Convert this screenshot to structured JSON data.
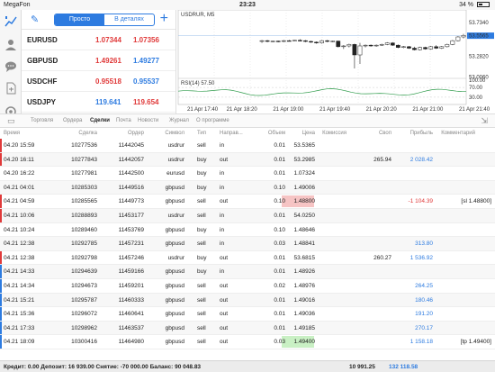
{
  "status": {
    "carrier": "MegaFon",
    "time": "23:23",
    "battery": "34 %"
  },
  "quotes": {
    "tab_simple": "Просто",
    "tab_detail": "В деталях",
    "rows": [
      {
        "symbol": "EURUSD",
        "bid": "1.07344",
        "ask": "1.07356",
        "bid_color": "#e03a3a",
        "ask_color": "#e03a3a"
      },
      {
        "symbol": "GBPUSD",
        "bid": "1.49261",
        "ask": "1.49277",
        "bid_color": "#e03a3a",
        "ask_color": "#2d7be0"
      },
      {
        "symbol": "USDCHF",
        "bid": "0.95518",
        "ask": "0.95537",
        "bid_color": "#e03a3a",
        "ask_color": "#2d7be0"
      },
      {
        "symbol": "USDJPY",
        "bid": "119.641",
        "ask": "119.654",
        "bid_color": "#2d7be0",
        "ask_color": "#e03a3a"
      }
    ]
  },
  "chart": {
    "title": "USDRUR, M5",
    "price_labels": [
      "53.7340",
      "53.5565",
      "53.2820",
      "53.0060"
    ],
    "current_price": "53.5565",
    "rsi_label": "RSI(14) 57.50",
    "rsi_levels": [
      "100.00",
      "70.00",
      "30.00"
    ],
    "time_labels": [
      "21 Apr 17:40",
      "21 Apr 18:20",
      "21 Apr 19:00",
      "21 Apr 19:40",
      "21 Apr 20:20",
      "21 Apr 21:00",
      "21 Apr 21:40"
    ],
    "candles": [
      {
        "o": 53.48,
        "h": 53.5,
        "l": 53.46,
        "c": 53.49
      },
      {
        "o": 53.49,
        "h": 53.5,
        "l": 53.47,
        "c": 53.48
      },
      {
        "o": 53.48,
        "h": 53.49,
        "l": 53.47,
        "c": 53.485
      },
      {
        "o": 53.485,
        "h": 53.49,
        "l": 53.47,
        "c": 53.48
      },
      {
        "o": 53.48,
        "h": 53.5,
        "l": 53.47,
        "c": 53.49
      },
      {
        "o": 53.49,
        "h": 53.5,
        "l": 53.48,
        "c": 53.485
      },
      {
        "o": 53.485,
        "h": 53.5,
        "l": 53.48,
        "c": 53.495
      },
      {
        "o": 53.495,
        "h": 53.51,
        "l": 53.48,
        "c": 53.49
      },
      {
        "o": 53.49,
        "h": 53.5,
        "l": 53.47,
        "c": 53.48
      },
      {
        "o": 53.48,
        "h": 53.49,
        "l": 53.46,
        "c": 53.47
      },
      {
        "o": 53.47,
        "h": 53.48,
        "l": 53.45,
        "c": 53.46
      },
      {
        "o": 53.46,
        "h": 53.5,
        "l": 53.45,
        "c": 53.49
      },
      {
        "o": 53.49,
        "h": 53.5,
        "l": 53.47,
        "c": 53.48
      },
      {
        "o": 53.48,
        "h": 53.49,
        "l": 53.47,
        "c": 53.485
      },
      {
        "o": 53.485,
        "h": 53.49,
        "l": 53.4,
        "c": 53.41
      },
      {
        "o": 53.41,
        "h": 53.43,
        "l": 53.38,
        "c": 53.42
      },
      {
        "o": 53.42,
        "h": 53.45,
        "l": 53.4,
        "c": 53.44
      },
      {
        "o": 53.44,
        "h": 53.45,
        "l": 53.12,
        "c": 53.3
      },
      {
        "o": 53.3,
        "h": 53.46,
        "l": 53.18,
        "c": 53.42
      },
      {
        "o": 53.42,
        "h": 53.44,
        "l": 53.4,
        "c": 53.43
      },
      {
        "o": 53.43,
        "h": 53.44,
        "l": 53.41,
        "c": 53.42
      },
      {
        "o": 53.42,
        "h": 53.44,
        "l": 53.41,
        "c": 53.43
      },
      {
        "o": 53.43,
        "h": 53.45,
        "l": 53.42,
        "c": 53.44
      },
      {
        "o": 53.44,
        "h": 53.47,
        "l": 53.43,
        "c": 53.46
      },
      {
        "o": 53.46,
        "h": 53.47,
        "l": 53.42,
        "c": 53.43
      },
      {
        "o": 53.43,
        "h": 53.44,
        "l": 53.39,
        "c": 53.4
      },
      {
        "o": 53.4,
        "h": 53.42,
        "l": 53.39,
        "c": 53.41
      },
      {
        "o": 53.41,
        "h": 53.42,
        "l": 53.38,
        "c": 53.39
      },
      {
        "o": 53.39,
        "h": 53.41,
        "l": 53.36,
        "c": 53.37
      },
      {
        "o": 53.37,
        "h": 53.41,
        "l": 53.36,
        "c": 53.4
      },
      {
        "o": 53.4,
        "h": 53.41,
        "l": 53.37,
        "c": 53.38
      },
      {
        "o": 53.38,
        "h": 53.42,
        "l": 53.37,
        "c": 53.41
      },
      {
        "o": 53.41,
        "h": 53.43,
        "l": 53.38,
        "c": 53.39
      },
      {
        "o": 53.39,
        "h": 53.42,
        "l": 53.38,
        "c": 53.41
      },
      {
        "o": 53.41,
        "h": 53.45,
        "l": 53.4,
        "c": 53.44
      },
      {
        "o": 53.44,
        "h": 53.5,
        "l": 53.43,
        "c": 53.49
      },
      {
        "o": 53.49,
        "h": 53.55,
        "l": 53.48,
        "c": 53.54
      },
      {
        "o": 53.54,
        "h": 53.58,
        "l": 53.52,
        "c": 53.56
      }
    ]
  },
  "tabs": {
    "items": [
      "Торговля",
      "Ордера",
      "Сделки",
      "Почта",
      "Новости",
      "Журнал",
      "О программе"
    ],
    "active": 2
  },
  "table": {
    "headers": [
      "Время",
      "Сделка",
      "Ордер",
      "Символ",
      "Тип",
      "Направ...",
      "Объем",
      "Цена",
      "Комиссия",
      "Своп",
      "Прибыль",
      "Комментарий"
    ],
    "rows": [
      {
        "time": "04.20 15:59",
        "deal": "10277536",
        "order": "11442045",
        "symbol": "usdrur",
        "type": "sell",
        "dir": "in",
        "vol": "0.01",
        "price": "53.5365",
        "commission": "",
        "swap": "",
        "profit": "",
        "comment": "",
        "mark": "#e03a3a",
        "hl": ""
      },
      {
        "time": "04.20 16:11",
        "deal": "10277843",
        "order": "11442057",
        "symbol": "usdrur",
        "type": "buy",
        "dir": "out",
        "vol": "0.01",
        "price": "53.2985",
        "commission": "",
        "swap": "265.94",
        "profit": "2 028.42",
        "comment": "",
        "mark": "#e03a3a",
        "hl": ""
      },
      {
        "time": "04.20 16:22",
        "deal": "10277981",
        "order": "11442500",
        "symbol": "eurusd",
        "type": "buy",
        "dir": "in",
        "vol": "0.01",
        "price": "1.07324",
        "commission": "",
        "swap": "",
        "profit": "",
        "comment": "",
        "mark": "",
        "hl": ""
      },
      {
        "time": "04.21 04:01",
        "deal": "10285303",
        "order": "11449516",
        "symbol": "gbpusd",
        "type": "buy",
        "dir": "in",
        "vol": "0.10",
        "price": "1.49006",
        "commission": "",
        "swap": "",
        "profit": "",
        "comment": "",
        "mark": "",
        "hl": ""
      },
      {
        "time": "04.21 04:59",
        "deal": "10285565",
        "order": "11449773",
        "symbol": "gbpusd",
        "type": "sell",
        "dir": "out",
        "vol": "0.10",
        "price": "1.48800",
        "commission": "",
        "swap": "",
        "profit": "-1 104.39",
        "comment": "[sl 1.48800]",
        "mark": "#e03a3a",
        "hl": "red"
      },
      {
        "time": "04.21 10:06",
        "deal": "10288893",
        "order": "11453177",
        "symbol": "usdrur",
        "type": "sell",
        "dir": "in",
        "vol": "0.01",
        "price": "54.0250",
        "commission": "",
        "swap": "",
        "profit": "",
        "comment": "",
        "mark": "#e03a3a",
        "hl": ""
      },
      {
        "time": "04.21 10:24",
        "deal": "10289460",
        "order": "11453769",
        "symbol": "gbpusd",
        "type": "buy",
        "dir": "in",
        "vol": "0.10",
        "price": "1.48646",
        "commission": "",
        "swap": "",
        "profit": "",
        "comment": "",
        "mark": "",
        "hl": ""
      },
      {
        "time": "04.21 12:38",
        "deal": "10292785",
        "order": "11457231",
        "symbol": "gbpusd",
        "type": "sell",
        "dir": "in",
        "vol": "0.03",
        "price": "1.48841",
        "commission": "",
        "swap": "",
        "profit": "313.80",
        "comment": "",
        "mark": "",
        "hl": ""
      },
      {
        "time": "04.21 12:38",
        "deal": "10292798",
        "order": "11457246",
        "symbol": "usdrur",
        "type": "buy",
        "dir": "out",
        "vol": "0.01",
        "price": "53.6815",
        "commission": "",
        "swap": "260.27",
        "profit": "1 536.92",
        "comment": "",
        "mark": "#e03a3a",
        "hl": ""
      },
      {
        "time": "04.21 14:33",
        "deal": "10294639",
        "order": "11459166",
        "symbol": "gbpusd",
        "type": "buy",
        "dir": "in",
        "vol": "0.01",
        "price": "1.48926",
        "commission": "",
        "swap": "",
        "profit": "",
        "comment": "",
        "mark": "#2d7be0",
        "hl": ""
      },
      {
        "time": "04.21 14:34",
        "deal": "10294673",
        "order": "11459201",
        "symbol": "gbpusd",
        "type": "sell",
        "dir": "out",
        "vol": "0.02",
        "price": "1.48976",
        "commission": "",
        "swap": "",
        "profit": "264.25",
        "comment": "",
        "mark": "#2d7be0",
        "hl": ""
      },
      {
        "time": "04.21 15:21",
        "deal": "10295787",
        "order": "11460333",
        "symbol": "gbpusd",
        "type": "sell",
        "dir": "out",
        "vol": "0.01",
        "price": "1.49016",
        "commission": "",
        "swap": "",
        "profit": "180.46",
        "comment": "",
        "mark": "#2d7be0",
        "hl": ""
      },
      {
        "time": "04.21 15:36",
        "deal": "10296072",
        "order": "11460641",
        "symbol": "gbpusd",
        "type": "sell",
        "dir": "out",
        "vol": "0.01",
        "price": "1.49036",
        "commission": "",
        "swap": "",
        "profit": "191.20",
        "comment": "",
        "mark": "#2d7be0",
        "hl": ""
      },
      {
        "time": "04.21 17:33",
        "deal": "10298962",
        "order": "11463537",
        "symbol": "gbpusd",
        "type": "sell",
        "dir": "out",
        "vol": "0.01",
        "price": "1.49185",
        "commission": "",
        "swap": "",
        "profit": "270.17",
        "comment": "",
        "mark": "#2d7be0",
        "hl": ""
      },
      {
        "time": "04.21 18:09",
        "deal": "10300416",
        "order": "11464980",
        "symbol": "gbpusd",
        "type": "sell",
        "dir": "out",
        "vol": "0.03",
        "price": "1.49400",
        "commission": "",
        "swap": "",
        "profit": "1 158.18",
        "comment": "[tp 1.49400]",
        "mark": "#2d7be0",
        "hl": "green"
      }
    ]
  },
  "footer": {
    "summary": "Кредит: 0.00 Депозит: 16 939.00 Снятие: -70 000.00 Баланс: 90 048.83",
    "swap_total": "10 991.25",
    "profit_total": "132 118.58"
  },
  "colors": {
    "accent": "#2d7be0",
    "down": "#e03a3a",
    "profit": "#2d7be0",
    "loss": "#e03a3a"
  }
}
